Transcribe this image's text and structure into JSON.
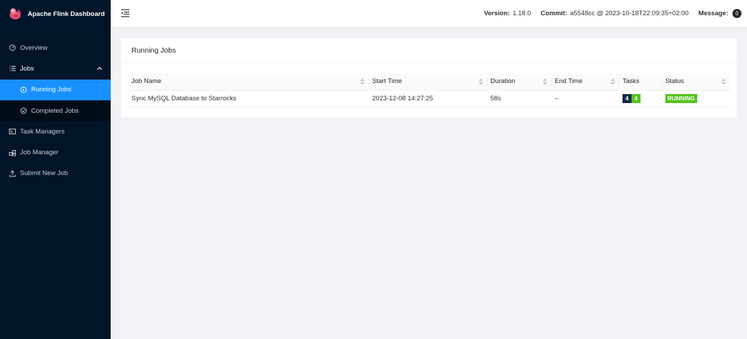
{
  "app": {
    "title": "Apache Flink Dashboard"
  },
  "sidebar": {
    "items": [
      {
        "label": "Overview",
        "icon": "dashboard-icon"
      },
      {
        "label": "Jobs",
        "icon": "list-icon"
      },
      {
        "label": "Running Jobs",
        "icon": "play-circle-icon"
      },
      {
        "label": "Completed Jobs",
        "icon": "check-circle-icon"
      },
      {
        "label": "Task Managers",
        "icon": "task-manager-icon"
      },
      {
        "label": "Job Manager",
        "icon": "cluster-icon"
      },
      {
        "label": "Submit New Job",
        "icon": "upload-icon"
      }
    ]
  },
  "header": {
    "version_label": "Version:",
    "version_value": "1.18.0",
    "commit_label": "Commit:",
    "commit_value": "a5548cc @ 2023-10-18T22:09:35+02:00",
    "message_label": "Message:",
    "message_count": "0"
  },
  "main": {
    "card_title": "Running Jobs",
    "columns": [
      "Job Name",
      "Start Time",
      "Duration",
      "End Time",
      "Tasks",
      "Status"
    ],
    "rows": [
      {
        "job_name": "Sync MySQL Database to Starrocks",
        "start_time": "2023-12-08 14:27:25",
        "duration": "58s",
        "end_time": "–",
        "tasks_total": "4",
        "tasks_running": "4",
        "status": "RUNNING"
      }
    ]
  },
  "colors": {
    "accent": "#1890ff",
    "sidebar_bg": "#011428",
    "running": "#52c41a",
    "task_dark": "#11284a"
  }
}
